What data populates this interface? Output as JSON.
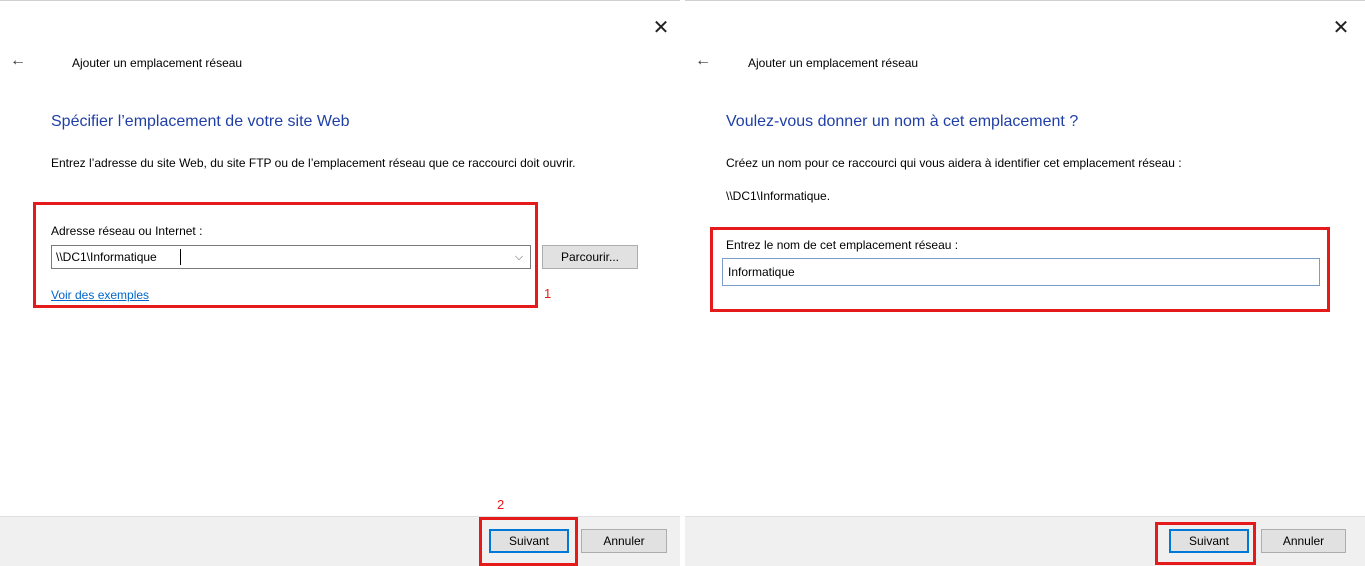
{
  "left": {
    "wizard_title": "Ajouter un emplacement réseau",
    "heading": "Spécifier l’emplacement de votre site Web",
    "description": "Entrez l’adresse du site Web, du site FTP ou de l’emplacement réseau que ce raccourci doit ouvrir.",
    "address_label": "Adresse réseau ou Internet :",
    "address_value": "\\\\DC1\\Informatique",
    "browse_label": "Parcourir...",
    "examples_link": "Voir des exemples",
    "next_label": "Suivant",
    "cancel_label": "Annuler",
    "annotation_1": "1",
    "annotation_2": "2"
  },
  "right": {
    "wizard_title": "Ajouter un emplacement réseau",
    "heading": "Voulez-vous donner un nom à cet emplacement ?",
    "description": "Créez un nom pour ce raccourci qui vous aidera à identifier cet emplacement réseau :",
    "path": "\\\\DC1\\Informatique.",
    "name_label": "Entrez le nom de cet emplacement réseau :",
    "name_value": "Informatique",
    "next_label": "Suivant",
    "cancel_label": "Annuler"
  },
  "icons": {
    "close": "close-icon",
    "back": "back-arrow-icon",
    "dropdown": "chevron-down-icon"
  },
  "colors": {
    "heading": "#1f3fa6",
    "annotation": "#e51a1a",
    "link": "#0066cc",
    "default_button_border": "#0078d7"
  }
}
